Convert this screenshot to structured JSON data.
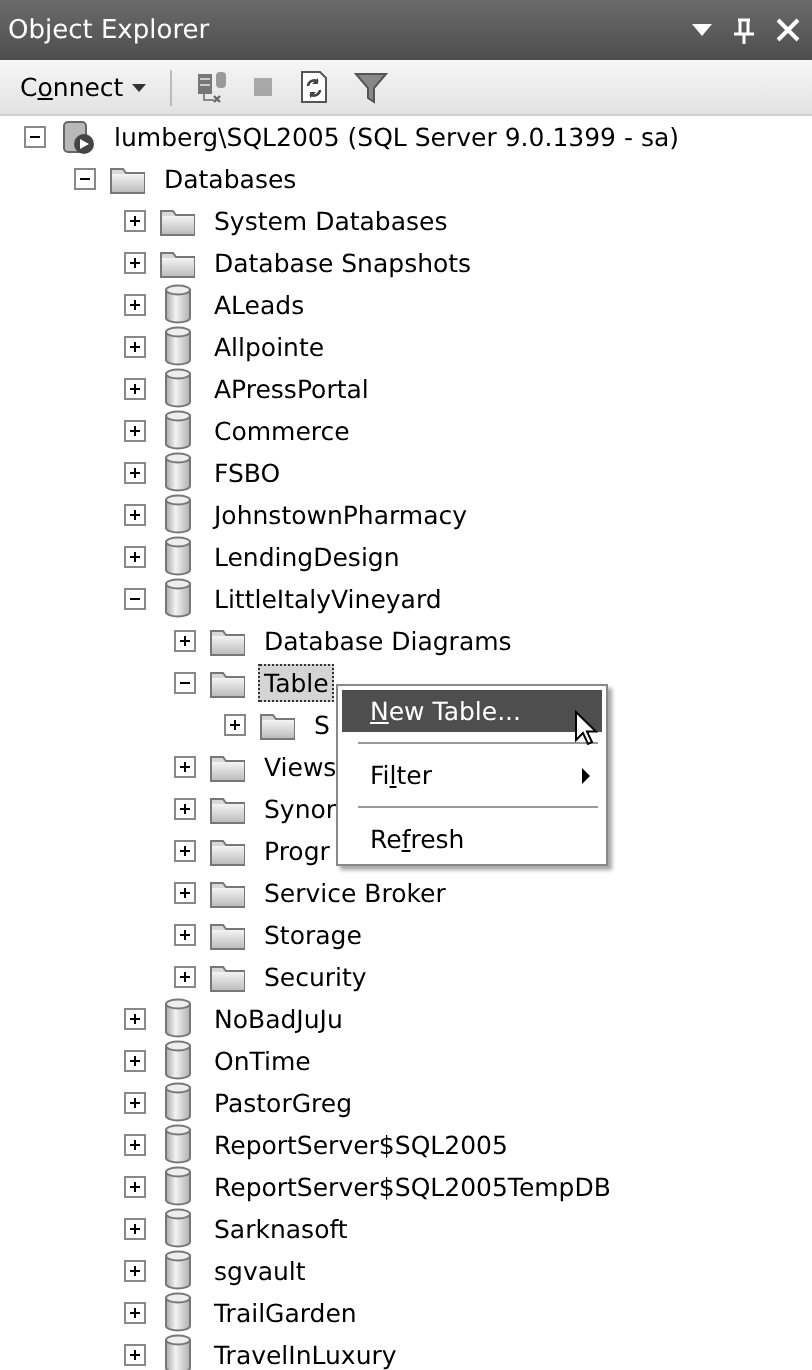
{
  "window": {
    "title": "Object Explorer"
  },
  "toolbar": {
    "buttons": [
      {
        "kind": "connect",
        "label_parts": [
          {
            "text": "C",
            "underlined": false
          },
          {
            "text": "o",
            "underlined": true
          },
          {
            "text": "nnect",
            "underlined": false
          }
        ],
        "disabled": false
      },
      {
        "kind": "disconnect",
        "disabled": false
      },
      {
        "kind": "stop",
        "disabled": true
      },
      {
        "kind": "refresh",
        "disabled": false
      },
      {
        "kind": "filter",
        "disabled": false
      }
    ]
  },
  "tree": [
    {
      "label": "lumberg\\SQL2005 (SQL Server 9.0.1399 - sa)",
      "kind": "server",
      "expanded": true,
      "selected": false,
      "children": [
        {
          "label": "Databases",
          "kind": "folder",
          "expanded": true,
          "selected": false,
          "children": [
            {
              "label": "System Databases",
              "kind": "folder",
              "expanded": false,
              "selected": false
            },
            {
              "label": "Database Snapshots",
              "kind": "folder",
              "expanded": false,
              "selected": false
            },
            {
              "label": "ALeads",
              "kind": "database",
              "expanded": false,
              "selected": false
            },
            {
              "label": "Allpointe",
              "kind": "database",
              "expanded": false,
              "selected": false
            },
            {
              "label": "APressPortal",
              "kind": "database",
              "expanded": false,
              "selected": false
            },
            {
              "label": "Commerce",
              "kind": "database",
              "expanded": false,
              "selected": false
            },
            {
              "label": "FSBO",
              "kind": "database",
              "expanded": false,
              "selected": false
            },
            {
              "label": "JohnstownPharmacy",
              "kind": "database",
              "expanded": false,
              "selected": false
            },
            {
              "label": "LendingDesign",
              "kind": "database",
              "expanded": false,
              "selected": false
            },
            {
              "label": "LittleItalyVineyard",
              "kind": "database",
              "expanded": true,
              "selected": false,
              "children": [
                {
                  "label": "Database Diagrams",
                  "kind": "folder",
                  "expanded": false,
                  "selected": false
                },
                {
                  "label": "Table",
                  "kind": "folder",
                  "expanded": true,
                  "selected": true,
                  "children": [
                    {
                      "label": "S",
                      "kind": "folder",
                      "expanded": false,
                      "selected": false
                    }
                  ]
                },
                {
                  "label": "Views",
                  "kind": "folder",
                  "expanded": false,
                  "selected": false
                },
                {
                  "label": "Synor",
                  "kind": "folder",
                  "expanded": false,
                  "selected": false
                },
                {
                  "label": "Progr",
                  "kind": "folder",
                  "expanded": false,
                  "selected": false
                },
                {
                  "label": "Service Broker",
                  "kind": "folder",
                  "expanded": false,
                  "selected": false
                },
                {
                  "label": "Storage",
                  "kind": "folder",
                  "expanded": false,
                  "selected": false
                },
                {
                  "label": "Security",
                  "kind": "folder",
                  "expanded": false,
                  "selected": false
                }
              ]
            },
            {
              "label": "NoBadJuJu",
              "kind": "database",
              "expanded": false,
              "selected": false
            },
            {
              "label": "OnTime",
              "kind": "database",
              "expanded": false,
              "selected": false
            },
            {
              "label": "PastorGreg",
              "kind": "database",
              "expanded": false,
              "selected": false
            },
            {
              "label": "ReportServer$SQL2005",
              "kind": "database",
              "expanded": false,
              "selected": false
            },
            {
              "label": "ReportServer$SQL2005TempDB",
              "kind": "database",
              "expanded": false,
              "selected": false
            },
            {
              "label": "Sarknasoft",
              "kind": "database",
              "expanded": false,
              "selected": false
            },
            {
              "label": "sgvault",
              "kind": "database",
              "expanded": false,
              "selected": false
            },
            {
              "label": "TrailGarden",
              "kind": "database",
              "expanded": false,
              "selected": false
            },
            {
              "label": "TravelInLuxury",
              "kind": "database",
              "expanded": false,
              "selected": false
            }
          ]
        }
      ]
    }
  ],
  "context_menu": {
    "items": [
      {
        "kind": "item",
        "label_parts": [
          {
            "text": "N",
            "underlined": true
          },
          {
            "text": "ew Table...",
            "underlined": false
          }
        ],
        "selected": true
      },
      {
        "kind": "separator"
      },
      {
        "kind": "submenu",
        "label_parts": [
          {
            "text": "Fi",
            "underlined": false
          },
          {
            "text": "l",
            "underlined": true
          },
          {
            "text": "ter",
            "underlined": false
          }
        ],
        "selected": false
      },
      {
        "kind": "separator"
      },
      {
        "kind": "item",
        "label_parts": [
          {
            "text": "Re",
            "underlined": false
          },
          {
            "text": "f",
            "underlined": true
          },
          {
            "text": "resh",
            "underlined": false
          }
        ],
        "selected": false
      }
    ]
  }
}
